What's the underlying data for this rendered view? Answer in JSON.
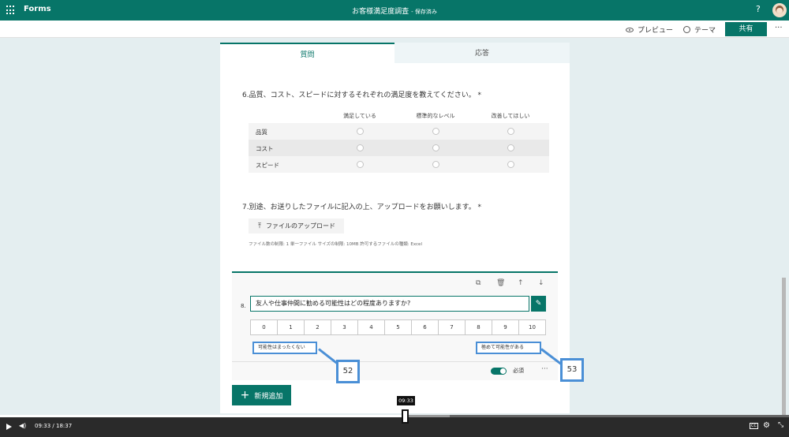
{
  "header": {
    "app_name": "Forms",
    "doc_title": "お客様満足度調査",
    "saved_status": "- 保存済み",
    "help": "?"
  },
  "commands": {
    "preview": "プレビュー",
    "theme": "テーマ",
    "share": "共有",
    "more": "···"
  },
  "tabs": {
    "questions": "質問",
    "responses": "応答"
  },
  "q6": {
    "title": "6.品質、コスト、スピードに対するそれぞれの満足度を教えてください。 *",
    "columns": [
      "満足している",
      "標準的なレベル",
      "改善してほしい"
    ],
    "rows": [
      "品質",
      "コスト",
      "スピード"
    ]
  },
  "q7": {
    "title": "7.別途、お送りしたファイルに記入の上、アップロードをお願いします。 *",
    "upload_label": "ファイルのアップロード",
    "note": "ファイル数の制限: 1 単一ファイル サイズの制限: 10MB 許可するファイルの種類: Excel"
  },
  "q8": {
    "number": "8.",
    "question": "友人や仕事仲間に勧める可能性はどの程度ありますか?",
    "scale": [
      "0",
      "1",
      "2",
      "3",
      "4",
      "5",
      "6",
      "7",
      "8",
      "9",
      "10"
    ],
    "low_label": "可能性はまったくない",
    "high_label": "極めて可能性がある",
    "required_label": "必須",
    "more": "···"
  },
  "add_new": "新規追加",
  "annotations": {
    "left": "52",
    "right": "53"
  },
  "player": {
    "current_time": "09:33",
    "total_time": "18:37",
    "separator": "/",
    "tooltip": "09:33",
    "progress_fraction": 0.513
  },
  "colors": {
    "brand": "#077568",
    "annotation": "#4a8fd6"
  }
}
